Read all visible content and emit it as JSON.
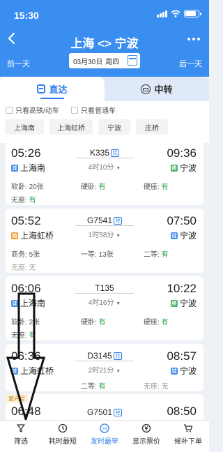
{
  "status_bar": {
    "time": "15:30"
  },
  "nav": {
    "title": "上海 <> 宁波",
    "back_icon": "chevron-left-icon",
    "more_icon": "more-dots-icon"
  },
  "date_bar": {
    "prev_label": "前一天",
    "next_label": "后一天",
    "date": "03月30日",
    "weekday": "周四"
  },
  "tabs": [
    {
      "label": "直达",
      "active": true,
      "icon": "train-icon"
    },
    {
      "label": "中转",
      "active": false,
      "icon": "transfer-icon"
    }
  ],
  "filters": {
    "checkboxes": [
      "只看高铁/动车",
      "只看普通车"
    ],
    "stations": [
      "上海南",
      "上海虹桥",
      "宁波",
      "庄桥"
    ]
  },
  "station_badges": {
    "pass": "过",
    "start": "始",
    "end": "终"
  },
  "trains": [
    {
      "dep_time": "05:26",
      "train_no": "K335",
      "arr_time": "09:36",
      "duration": "4时10分",
      "dep_station": "上海南",
      "arr_station": "宁波",
      "seats_row1": [
        {
          "label": "软卧: ",
          "value": "20张"
        },
        {
          "label": "硬卧: ",
          "value": "有"
        },
        {
          "label": "硬座: ",
          "value": "有"
        }
      ],
      "seats_row2": [
        {
          "label": "无座: ",
          "value": "有"
        }
      ]
    },
    {
      "dep_time": "05:52",
      "train_no": "G7541",
      "arr_time": "07:50",
      "duration": "1时58分",
      "dep_station": "上海虹桥",
      "arr_station": "宁波",
      "seats_row1": [
        {
          "label": "商务: ",
          "value": "5张"
        },
        {
          "label": "一等: ",
          "value": "13张"
        },
        {
          "label": "二等: ",
          "value": "有"
        }
      ],
      "seats_row2": [
        {
          "label": "无座: ",
          "value": "无"
        }
      ]
    },
    {
      "dep_time": "06:06",
      "train_no": "T135",
      "arr_time": "10:22",
      "duration": "4时16分",
      "dep_station": "上海南",
      "arr_station": "宁波",
      "seats_row1": [
        {
          "label": "软卧: ",
          "value": "2张"
        },
        {
          "label": "硬卧: ",
          "value": "有"
        },
        {
          "label": "硬座: ",
          "value": "有"
        }
      ],
      "seats_row2": [
        {
          "label": "无座: ",
          "value": "有"
        }
      ]
    },
    {
      "dep_time": "06:36",
      "train_no": "D3145",
      "arr_time": "08:57",
      "duration": "2时21分",
      "dep_station": "上海虹桥",
      "arr_station": "宁波",
      "seats_row1": [
        {
          "label": "二等: ",
          "value": "有"
        },
        {
          "label": "无座: ",
          "value": "无"
        }
      ],
      "seats_row2": []
    },
    {
      "dep_time": "06:48",
      "train_no": "G7501",
      "arr_time": "08:50",
      "tag": "复兴号"
    }
  ],
  "bottom_bar": [
    {
      "label": "筛选",
      "icon": "filter-icon"
    },
    {
      "label": "耗时最短",
      "icon": "clock-icon"
    },
    {
      "label": "发时最早",
      "icon": "24h-icon",
      "active": true
    },
    {
      "label": "显示票价",
      "icon": "yen-icon"
    },
    {
      "label": "候补下单",
      "icon": "cart-icon"
    }
  ],
  "colors": {
    "primary": "#3a8ef0",
    "accent": "#2f7fe6",
    "available": "#2aa54a",
    "unavailable": "#999999"
  }
}
